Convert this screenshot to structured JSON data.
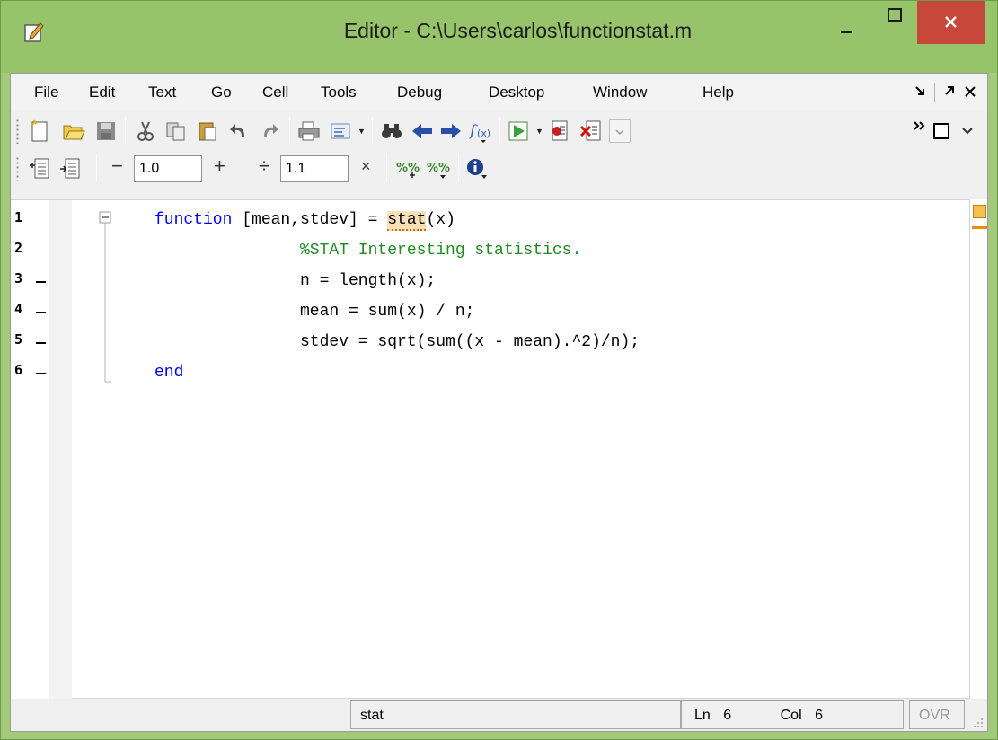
{
  "window": {
    "title": "Editor - C:\\Users\\carlos\\functionstat.m",
    "accent_color": "#97c36a",
    "close_color": "#c8473b"
  },
  "menu": {
    "items": [
      "File",
      "Edit",
      "Text",
      "Go",
      "Cell",
      "Tools",
      "Debug",
      "Desktop",
      "Window",
      "Help"
    ],
    "right_controls": [
      "undock-icon",
      "maximize-docked-icon",
      "close-docked-icon"
    ]
  },
  "toolbar1": {
    "icons": [
      "new-file-icon",
      "open-folder-icon",
      "save-icon",
      "cut-icon",
      "copy-icon",
      "paste-icon",
      "undo-icon",
      "redo-icon",
      "print-icon",
      "format-icon",
      "find-icon",
      "back-icon",
      "forward-icon",
      "function-browser-icon",
      "run-icon",
      "step-icon",
      "clear-breakpoints-icon",
      "stack-dropdown",
      "overflow-chevron-icon",
      "layout-icon"
    ]
  },
  "toolbar2": {
    "icons": [
      "insert-cell-icon",
      "cell-divider-icon",
      "decrement-icon",
      "increment-icon",
      "divide-icon",
      "multiply-icon",
      "evaluate-cell-icon",
      "evaluate-advance-icon",
      "info-icon"
    ],
    "decrement_label": "−",
    "increment_label": "+",
    "divide_label": "÷",
    "multiply_label": "×",
    "value1": "1.0",
    "value2": "1.1"
  },
  "editor": {
    "lines": [
      {
        "num": "1",
        "has_dash": false
      },
      {
        "num": "2",
        "has_dash": false
      },
      {
        "num": "3",
        "has_dash": true
      },
      {
        "num": "4",
        "has_dash": true
      },
      {
        "num": "5",
        "has_dash": true
      },
      {
        "num": "6",
        "has_dash": true
      }
    ],
    "code": {
      "l1_kw": "function",
      "l1_rest_a": " [mean,stdev] = ",
      "l1_fn": "stat",
      "l1_rest_b": "(x)",
      "l2_comment": "%STAT Interesting statistics.",
      "l3": "n = length(x);",
      "l4": "mean = sum(x) / n;",
      "l5": "stdev = sqrt(sum((x - mean).^2)/n);",
      "l6_kw": "end"
    },
    "colors": {
      "keyword": "#0000ff",
      "comment": "#228b22",
      "highlight": "#f8e0b8"
    }
  },
  "status": {
    "function_name": "stat",
    "ln_label": "Ln",
    "ln_value": "6",
    "col_label": "Col",
    "col_value": "6",
    "mode": "OVR"
  }
}
